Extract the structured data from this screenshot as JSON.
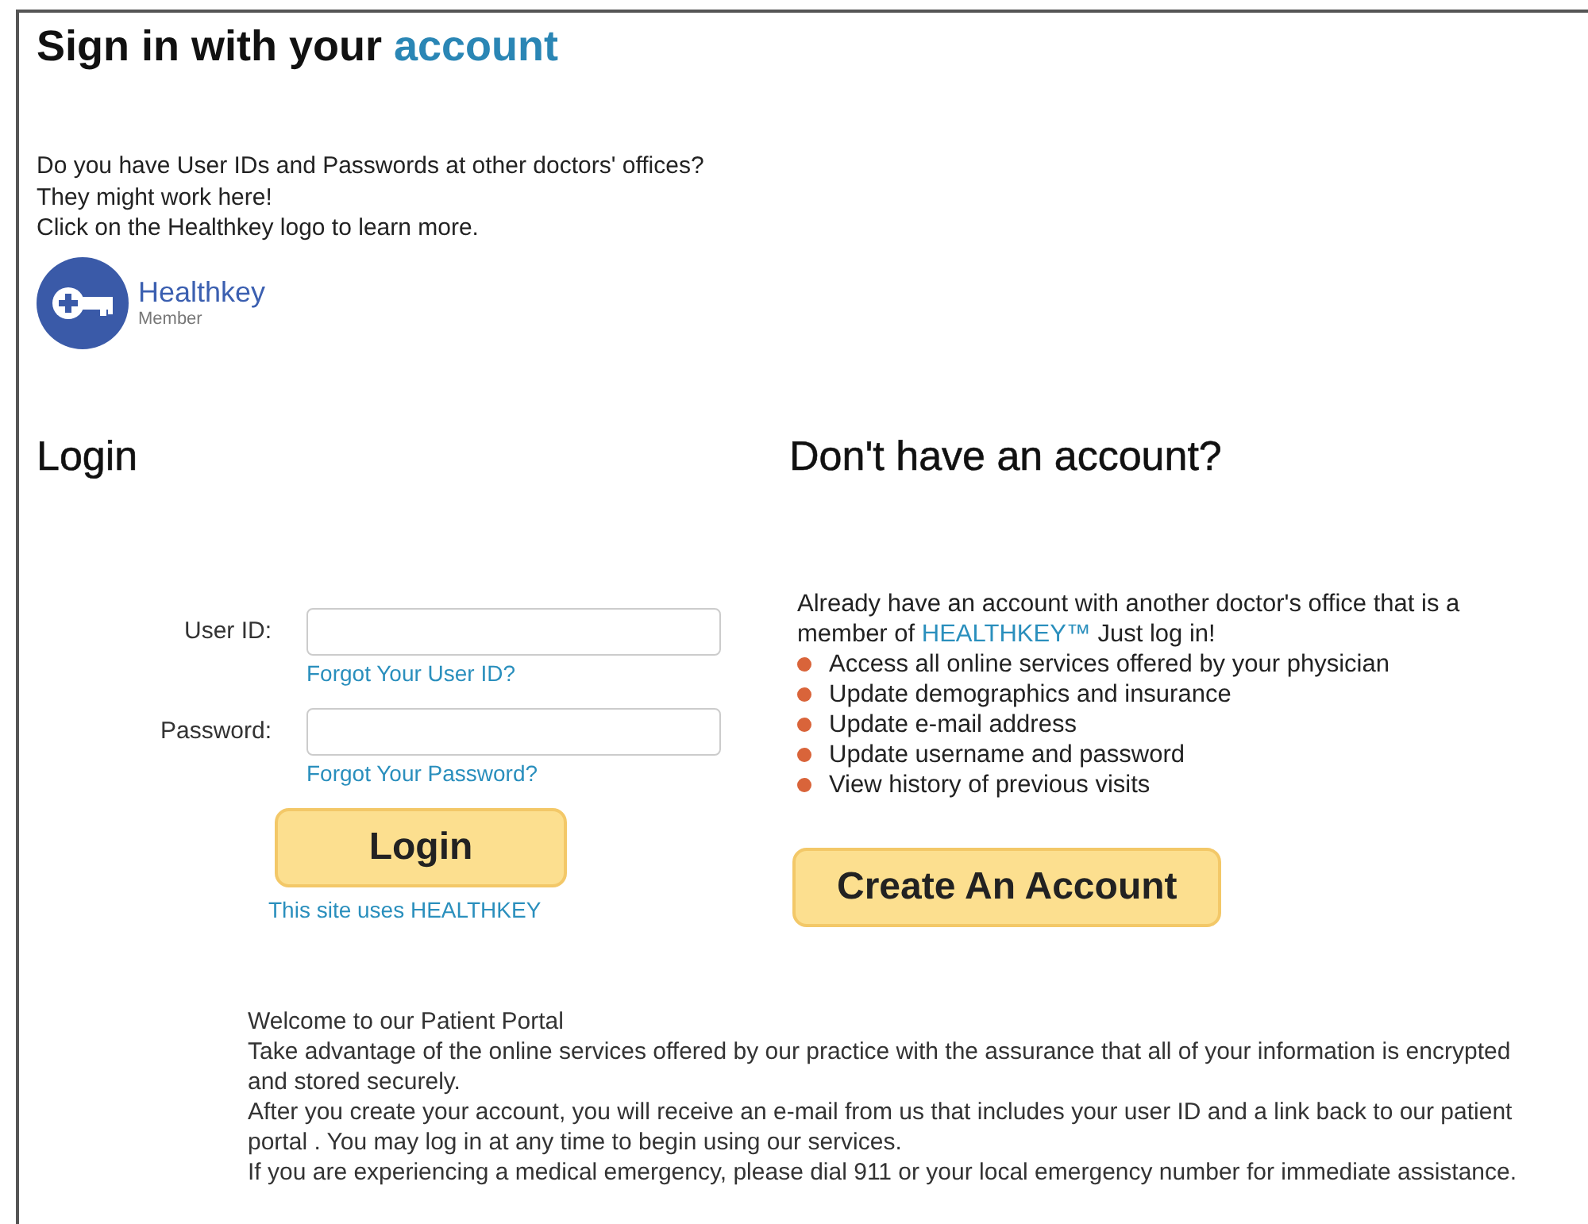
{
  "header": {
    "title": "Sign in with your",
    "title_highlight": "account"
  },
  "intro": [
    "Do you have User IDs and Passwords at other doctors' offices?",
    "They might work here!",
    "Click on the Healthkey logo to learn more."
  ],
  "logo": {
    "name": "Healthkey",
    "caption": "Member"
  },
  "login": {
    "heading": "Login",
    "fields": [
      {
        "label": "User ID:",
        "link": "Forgot Your User ID?"
      },
      {
        "label": "Password:",
        "link": "Forgot Your Password?"
      }
    ],
    "button": "Login",
    "footer_link": "This site uses HEALTHKEY"
  },
  "signup": {
    "heading": "Don't have an account?",
    "text_before": "Already have an account with another doctor's office that is a member of",
    "link": "HEALTHKEY™",
    "text_after": "Just log in!",
    "benefits": [
      "Access all online services offered by your physician",
      "Update demographics and insurance",
      "Update e-mail address",
      "Update username and password",
      "View history of previous visits"
    ],
    "button": "Create An Account"
  },
  "welcome": [
    "Welcome to our Patient Portal",
    "Take advantage of the online services offered by our practice with the assurance that all of your information is encrypted and stored securely.",
    "After you create your account, you will receive an e-mail from us that includes your user ID and a link back to our patient portal . You may log in at any time to begin using our services.",
    "If you are experiencing a medical emergency, please dial 911 or your local emergency number for immediate assistance."
  ]
}
